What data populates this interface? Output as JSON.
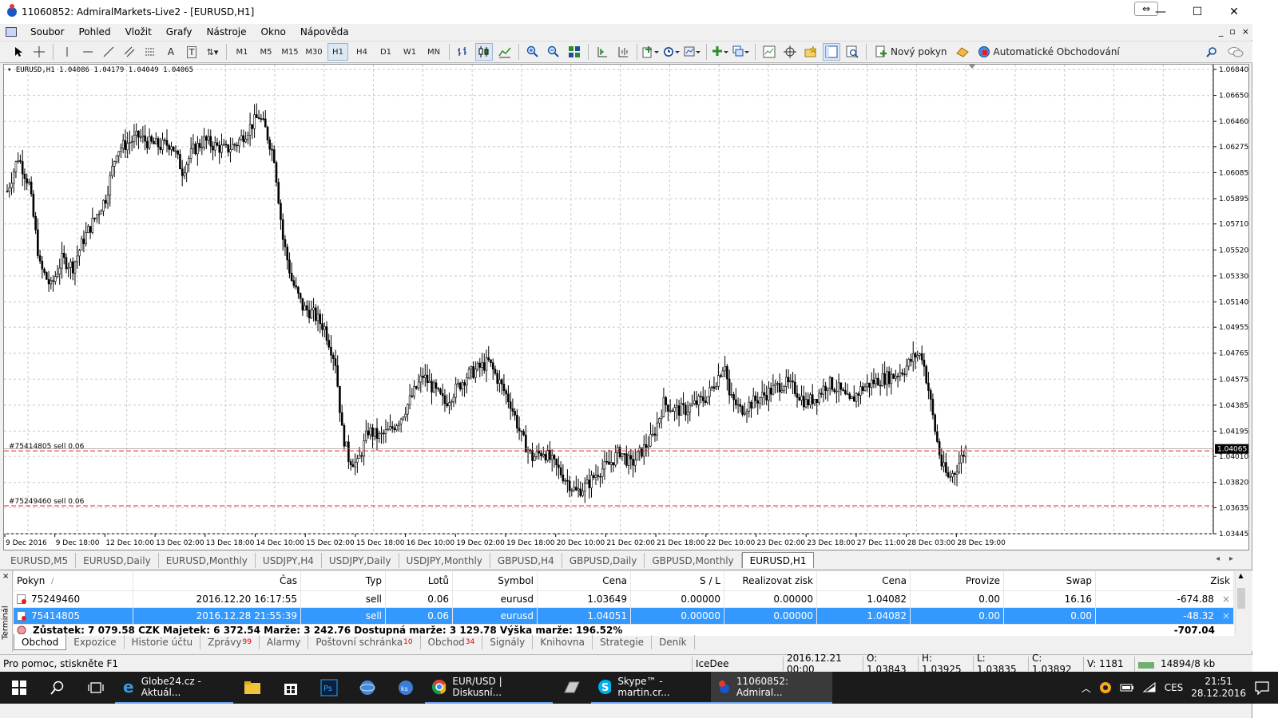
{
  "window": {
    "title": "11060852: AdmiralMarkets-Live2 - [EURUSD,H1]",
    "resize_icon": "⇔",
    "min": "—",
    "max": "☐",
    "close": "✕"
  },
  "menu": [
    "Soubor",
    "Pohled",
    "Vložit",
    "Grafy",
    "Nástroje",
    "Okno",
    "Nápověda"
  ],
  "mdi_buttons": [
    "_",
    "▫",
    "×"
  ],
  "toolbar": {
    "timeframes": [
      "M1",
      "M5",
      "M15",
      "M30",
      "H1",
      "H4",
      "D1",
      "W1",
      "MN"
    ],
    "selected_timeframe": "H1",
    "new_order": "Nový pokyn",
    "auto_trading": "Automatické Obchodování"
  },
  "chart": {
    "info": "EURUSD,H1  1.04086 1.04179 1.04049 1.04065",
    "current_price_label": "1.04065",
    "order_lines": [
      {
        "label": "#75414805 sell 0.06",
        "price": 1.04051
      },
      {
        "label": "#75249460 sell 0.06",
        "price": 1.03649
      }
    ],
    "price_ticks": [
      "1.06840",
      "1.06650",
      "1.06460",
      "1.06275",
      "1.06085",
      "1.05895",
      "1.05710",
      "1.05520",
      "1.05330",
      "1.05140",
      "1.04955",
      "1.04765",
      "1.04575",
      "1.04385",
      "1.04195",
      "1.04010",
      "1.03820",
      "1.03635",
      "1.03445"
    ],
    "time_ticks": [
      "9 Dec 2016",
      "9 Dec 18:00",
      "12 Dec 10:00",
      "13 Dec 02:00",
      "13 Dec 18:00",
      "14 Dec 10:00",
      "15 Dec 02:00",
      "15 Dec 18:00",
      "16 Dec 10:00",
      "19 Dec 02:00",
      "19 Dec 18:00",
      "20 Dec 10:00",
      "21 Dec 02:00",
      "21 Dec 18:00",
      "22 Dec 10:00",
      "23 Dec 02:00",
      "23 Dec 18:00",
      "27 Dec 11:00",
      "28 Dec 03:00",
      "28 Dec 19:00"
    ]
  },
  "chart_data": {
    "type": "candlestick",
    "symbol": "EURUSD",
    "timeframe": "H1",
    "ylim": [
      1.03445,
      1.0684
    ],
    "grid": true,
    "last_close": 1.04065,
    "close_path": [
      [
        0,
        1.0595
      ],
      [
        5,
        1.062
      ],
      [
        10,
        1.06
      ],
      [
        15,
        1.054
      ],
      [
        20,
        1.0525
      ],
      [
        25,
        1.0545
      ],
      [
        30,
        1.054
      ],
      [
        35,
        1.056
      ],
      [
        40,
        1.0575
      ],
      [
        45,
        1.059
      ],
      [
        50,
        1.0625
      ],
      [
        55,
        1.063
      ],
      [
        60,
        1.0635
      ],
      [
        65,
        1.063
      ],
      [
        70,
        1.0628
      ],
      [
        75,
        1.063
      ],
      [
        80,
        1.061
      ],
      [
        85,
        1.0625
      ],
      [
        90,
        1.0632
      ],
      [
        95,
        1.0628
      ],
      [
        100,
        1.0625
      ],
      [
        105,
        1.063
      ],
      [
        110,
        1.064
      ],
      [
        115,
        1.065
      ],
      [
        118,
        1.064
      ],
      [
        122,
        1.062
      ],
      [
        126,
        1.056
      ],
      [
        130,
        1.053
      ],
      [
        135,
        1.051
      ],
      [
        140,
        1.0505
      ],
      [
        145,
        1.0495
      ],
      [
        150,
        1.047
      ],
      [
        153,
        1.042
      ],
      [
        156,
        1.04
      ],
      [
        160,
        1.0395
      ],
      [
        165,
        1.042
      ],
      [
        170,
        1.0415
      ],
      [
        175,
        1.042
      ],
      [
        180,
        1.043
      ],
      [
        185,
        1.0445
      ],
      [
        190,
        1.046
      ],
      [
        195,
        1.045
      ],
      [
        200,
        1.044
      ],
      [
        205,
        1.045
      ],
      [
        210,
        1.046
      ],
      [
        215,
        1.0465
      ],
      [
        220,
        1.047
      ],
      [
        225,
        1.0455
      ],
      [
        230,
        1.044
      ],
      [
        235,
        1.0415
      ],
      [
        240,
        1.04
      ],
      [
        245,
        1.0405
      ],
      [
        250,
        1.0395
      ],
      [
        255,
        1.0385
      ],
      [
        260,
        1.0375
      ],
      [
        265,
        1.038
      ],
      [
        270,
        1.039
      ],
      [
        275,
        1.0395
      ],
      [
        280,
        1.0405
      ],
      [
        285,
        1.0395
      ],
      [
        290,
        1.0405
      ],
      [
        295,
        1.0415
      ],
      [
        300,
        1.044
      ],
      [
        305,
        1.0435
      ],
      [
        310,
        1.0435
      ],
      [
        315,
        1.044
      ],
      [
        320,
        1.0445
      ],
      [
        325,
        1.046
      ],
      [
        328,
        1.047
      ],
      [
        330,
        1.0445
      ],
      [
        335,
        1.0435
      ],
      [
        340,
        1.044
      ],
      [
        345,
        1.0445
      ],
      [
        350,
        1.045
      ],
      [
        355,
        1.0455
      ],
      [
        360,
        1.045
      ],
      [
        365,
        1.044
      ],
      [
        370,
        1.0445
      ],
      [
        375,
        1.0455
      ],
      [
        380,
        1.045
      ],
      [
        385,
        1.044
      ],
      [
        390,
        1.045
      ],
      [
        395,
        1.0455
      ],
      [
        400,
        1.0458
      ],
      [
        405,
        1.046
      ],
      [
        410,
        1.0465
      ],
      [
        415,
        1.0475
      ],
      [
        418,
        1.0475
      ],
      [
        421,
        1.045
      ],
      [
        424,
        1.042
      ],
      [
        427,
        1.0395
      ],
      [
        430,
        1.0385
      ],
      [
        433,
        1.039
      ],
      [
        436,
        1.04
      ],
      [
        438,
        1.04065
      ]
    ],
    "x_range": [
      0,
      438
    ]
  },
  "chart_tabs": [
    "EURUSD,M5",
    "EURUSD,Daily",
    "EURUSD,Monthly",
    "USDJPY,H4",
    "USDJPY,Daily",
    "USDJPY,Monthly",
    "GBPUSD,H4",
    "GBPUSD,Daily",
    "GBPUSD,Monthly",
    "EURUSD,H1"
  ],
  "chart_tabs_active": "EURUSD,H1",
  "chart_tab_arrows": "◂▸",
  "terminal": {
    "side_label": "Terminál",
    "close": "×",
    "columns": [
      "Pokyn",
      "Čas",
      "Typ",
      "Lotů",
      "Symbol",
      "Cena",
      "S / L",
      "Realizovat zisk",
      "Cena",
      "Provize",
      "Swap",
      "Zisk"
    ],
    "rows": [
      [
        "75249460",
        "2016.12.20 16:17:55",
        "sell",
        "0.06",
        "eurusd",
        "1.03649",
        "0.00000",
        "0.00000",
        "1.04082",
        "0.00",
        "16.16",
        "-674.88"
      ],
      [
        "75414805",
        "2016.12.28 21:55:39",
        "sell",
        "0.06",
        "eurusd",
        "1.04051",
        "0.00000",
        "0.00000",
        "1.04082",
        "0.00",
        "0.00",
        "-48.32"
      ]
    ],
    "selected_row": 1,
    "summary": "Zůstatek: 7 079.58 CZK  Majetek: 6 372.54  Marže: 3 242.76  Dostupná marže: 3 129.78  Výška marže: 196.52%",
    "summary_total": "-707.04",
    "tabs": [
      {
        "label": "Obchod",
        "badge": ""
      },
      {
        "label": "Expozice",
        "badge": ""
      },
      {
        "label": "Historie účtu",
        "badge": ""
      },
      {
        "label": "Zprávy",
        "badge": "99"
      },
      {
        "label": "Alarmy",
        "badge": ""
      },
      {
        "label": "Poštovní schránka",
        "badge": "10"
      },
      {
        "label": "Obchod",
        "badge": "34"
      },
      {
        "label": "Signály",
        "badge": ""
      },
      {
        "label": "Knihovna",
        "badge": ""
      },
      {
        "label": "Strategie",
        "badge": ""
      },
      {
        "label": "Deník",
        "badge": ""
      }
    ]
  },
  "status": {
    "help": "Pro pomoc, stiskněte F1",
    "profile": "IceDee",
    "datetime": "2016.12.21 00:00",
    "open": "O: 1.03843",
    "high": "H: 1.03925",
    "low": "L: 1.03835",
    "close": "C: 1.03892",
    "volume": "V: 1181",
    "traffic": "14894/8 kb"
  },
  "taskbar": {
    "apps": [
      {
        "label": "Globe24.cz - Aktuál...",
        "icon": "edge-icon"
      },
      {
        "label": "EUR/USD | Diskusní...",
        "icon": "chrome-icon"
      },
      {
        "label": "Skype™ - martin.cr...",
        "icon": "skype-icon"
      },
      {
        "label": "11060852: Admiral...",
        "icon": "metatrader-icon"
      }
    ],
    "lang": "CES",
    "time": "21:51",
    "date": "28.12.2016"
  },
  "colors": {
    "selection": "#3399ff",
    "order_line": "#e02020",
    "taskbar": "#1b1b1b",
    "badge": "#dd0000"
  }
}
